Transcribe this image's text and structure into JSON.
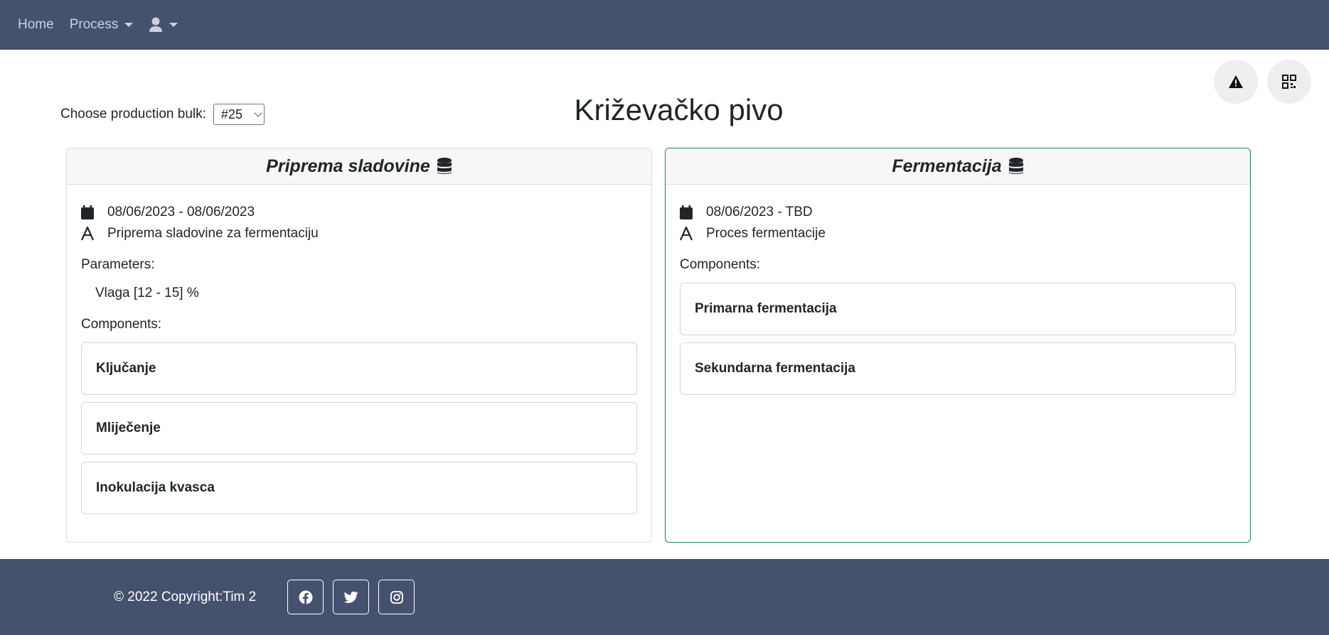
{
  "nav": {
    "home": "Home",
    "process": "Process"
  },
  "page": {
    "title": "Križevačko pivo",
    "bulk_label": "Choose production bulk:",
    "bulk_selected": "#25"
  },
  "cards": [
    {
      "title": "Priprema sladovine",
      "date_range": "08/06/2023 - 08/06/2023",
      "description": "Priprema sladovine za fermentaciju",
      "parameters_label": "Parameters:",
      "parameters": [
        "Vlaga [12 - 15] %"
      ],
      "components_label": "Components:",
      "components": [
        "Ključanje",
        "Mliječenje",
        "Inokulacija kvasca"
      ]
    },
    {
      "title": "Fermentacija",
      "date_range": "08/06/2023 - TBD",
      "description": "Proces fermentacije",
      "components_label": "Components:",
      "components": [
        "Primarna fermentacija",
        "Sekundarna fermentacija"
      ]
    }
  ],
  "footer": {
    "copyright": "© 2022 Copyright:Tim 2",
    "socials": [
      "facebook-icon",
      "twitter-icon",
      "instagram-icon"
    ]
  },
  "colors": {
    "nav_bg": "#45526e",
    "active_border": "#198754"
  }
}
